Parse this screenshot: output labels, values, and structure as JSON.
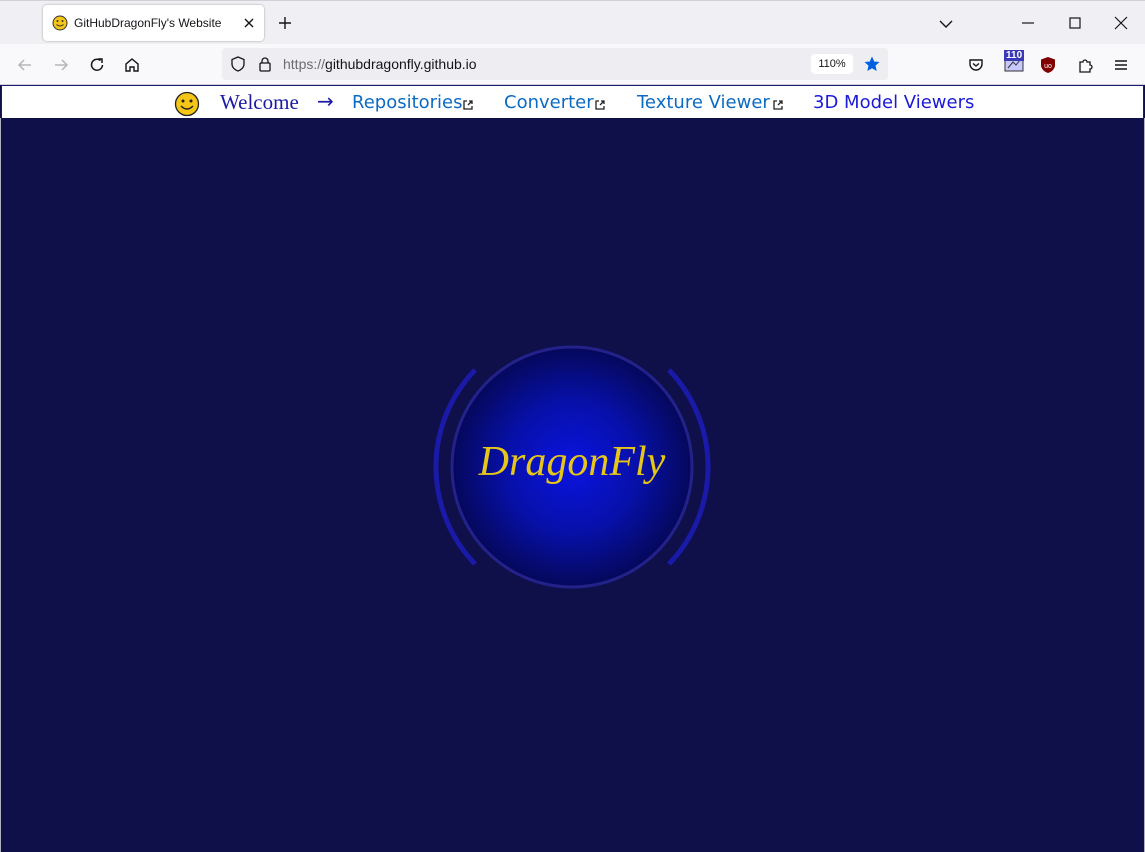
{
  "browser": {
    "tab": {
      "title": "GitHubDragonFly's Website"
    },
    "url": {
      "scheme": "https://",
      "host": "githubdragonfly.github.io"
    },
    "zoom": "110%",
    "extension_badge": "110"
  },
  "site": {
    "nav": {
      "welcome": "Welcome",
      "arrow": "→",
      "links": [
        "Repositories",
        "Converter",
        "Texture Viewer",
        "3D Model Viewers"
      ]
    },
    "logo_text": "DragonFly"
  },
  "colors": {
    "page_background": "#0f0f4a",
    "logo_text": "#e6c619",
    "link": "#0b6bc4",
    "welcome": "#1a1aa6",
    "orb_center": "#0a14d8"
  }
}
